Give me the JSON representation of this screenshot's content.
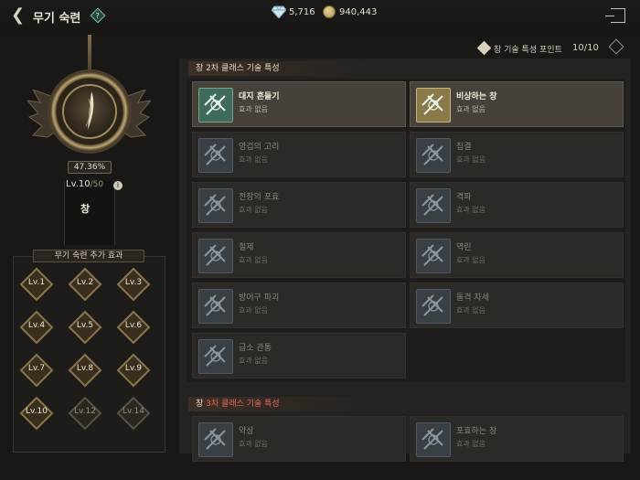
{
  "header": {
    "title": "무기 숙련",
    "help": "?",
    "gems": "5,716",
    "gold": "940,443"
  },
  "mastery": {
    "percent": "47.36%",
    "level": "Lv.10",
    "max": "/50",
    "weapon": "창",
    "info": "i"
  },
  "bonus": {
    "title": "무기 숙련 추가 효과",
    "levels": [
      {
        "label": "Lv.1",
        "unlocked": true
      },
      {
        "label": "Lv.2",
        "unlocked": true
      },
      {
        "label": "Lv.3",
        "unlocked": true
      },
      {
        "label": "Lv.4",
        "unlocked": true
      },
      {
        "label": "Lv.5",
        "unlocked": true
      },
      {
        "label": "Lv.6",
        "unlocked": true
      },
      {
        "label": "Lv.7",
        "unlocked": true
      },
      {
        "label": "Lv.8",
        "unlocked": true
      },
      {
        "label": "Lv.9",
        "unlocked": true
      },
      {
        "label": "Lv.10",
        "unlocked": true
      },
      {
        "label": "Lv.12",
        "unlocked": false
      },
      {
        "label": "Lv.14",
        "unlocked": false
      }
    ]
  },
  "points": {
    "label": "창 기술 특성 포인트",
    "value": "10/10"
  },
  "sections": [
    {
      "prefix": "창 ",
      "accent": "2차",
      "suffix": " 클래스 기술 특성"
    },
    {
      "prefix": "창 ",
      "accent": "3차",
      "suffix": " 클래스 기술 특성"
    }
  ],
  "skills2": [
    {
      "name": "대지 흔들기",
      "effect": "효과 없음",
      "active": true,
      "style": "green"
    },
    {
      "name": "비상하는 창",
      "effect": "효과 없음",
      "active": true,
      "style": "gold"
    },
    {
      "name": "영겁의 고리",
      "effect": "효과 없음",
      "active": false
    },
    {
      "name": "집결",
      "effect": "효과 없음",
      "active": false
    },
    {
      "name": "전장의 포효",
      "effect": "효과 없음",
      "active": false
    },
    {
      "name": "격파",
      "effect": "효과 없음",
      "active": false
    },
    {
      "name": "절제",
      "effect": "효과 없음",
      "active": false
    },
    {
      "name": "역린",
      "effect": "효과 없음",
      "active": false
    },
    {
      "name": "방어구 파괴",
      "effect": "효과 없음",
      "active": false
    },
    {
      "name": "돌격 자세",
      "effect": "효과 없음",
      "active": false
    },
    {
      "name": "급소 관통",
      "effect": "효과 없음",
      "active": false
    }
  ],
  "skills3": [
    {
      "name": "약상",
      "effect": "효과 없음",
      "active": false
    },
    {
      "name": "포효하는 창",
      "effect": "효과 없음",
      "active": false
    }
  ],
  "colors": {
    "accent_red": "#e06a5a",
    "active_green": "#3e6b5a",
    "active_gold": "#8a7a4a"
  }
}
